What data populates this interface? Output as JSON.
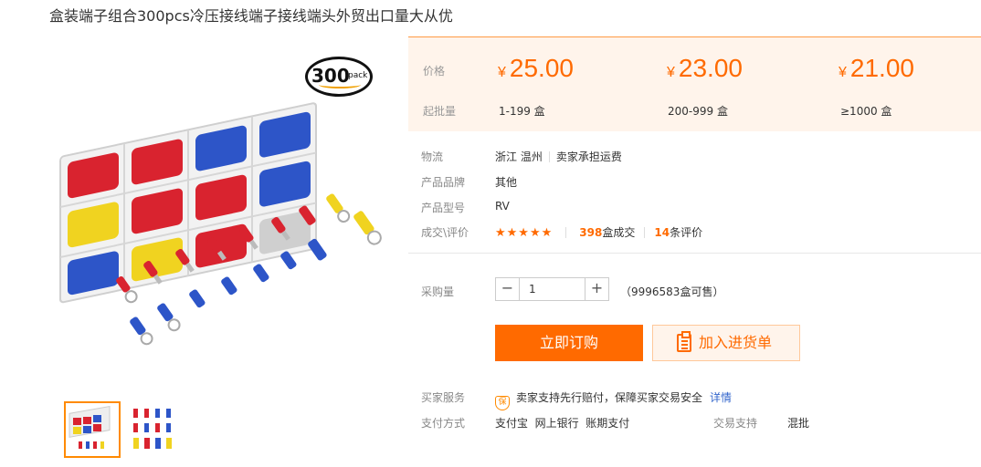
{
  "product_title": "盒装端子组合300pcs冷压接线端子接线端头外贸出口量大从优",
  "gallery": {
    "badge_number": "300",
    "badge_text": "pack"
  },
  "price_panel": {
    "price_label": "价格",
    "moq_label": "起批量",
    "tiers": [
      {
        "currency": "¥",
        "price": "25.00",
        "range": "1-199 盒"
      },
      {
        "currency": "¥",
        "price": "23.00",
        "range": "200-999 盒"
      },
      {
        "currency": "¥",
        "price": "21.00",
        "range": "≥1000 盒"
      }
    ]
  },
  "details": {
    "logistics_label": "物流",
    "location": "浙江 温州",
    "shipping": "卖家承担运费",
    "brand_label": "产品品牌",
    "brand": "其他",
    "model_label": "产品型号",
    "model": "RV",
    "deals_label": "成交\\评价",
    "stars": "★★★★★",
    "rating": 5,
    "deals_count": "398",
    "deals_unit": "盒成交",
    "reviews_count": "14",
    "reviews_unit": "条评价"
  },
  "purchase": {
    "qty_label": "采购量",
    "minus": "−",
    "plus": "+",
    "quantity": "1",
    "stock": "（9996583盒可售）",
    "buy_button": "立即订购",
    "cart_button": "加入进货单"
  },
  "services": {
    "buyer_label": "买家服务",
    "guarantee_icon": "保",
    "guarantee_text": "卖家支持先行赔付，保障买家交易安全",
    "details_link": "详情",
    "payment_label": "支付方式",
    "payment_methods": "支付宝  网上银行  账期支付",
    "trade_label": "交易支持",
    "trade_value": "混批"
  },
  "colors": {
    "accent": "#ff6a00",
    "price_panel_bg": "#fff4eb",
    "link": "#3366cc"
  }
}
